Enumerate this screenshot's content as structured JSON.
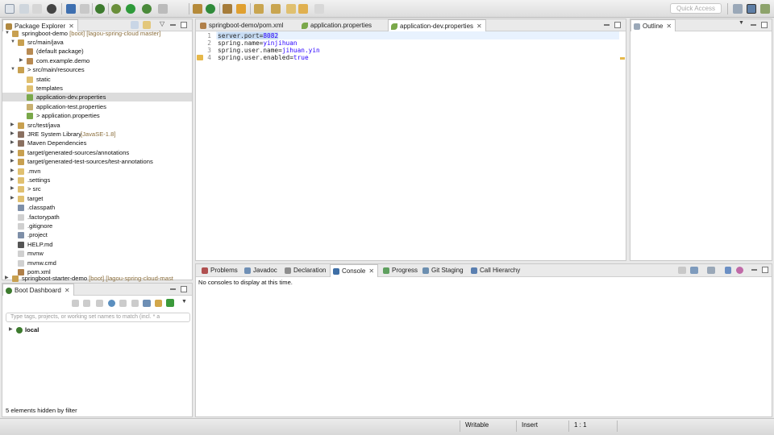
{
  "toolbar": {
    "quick_access_placeholder": "Quick Access"
  },
  "package_explorer": {
    "title": "Package Explorer",
    "project_name": "springboot-demo",
    "project_suffix": "[boot] [lagou-spring-cloud master]",
    "items": [
      {
        "label": "src/main/java",
        "indent": 1,
        "arrow": "open",
        "icon": "source-folder-icon"
      },
      {
        "label": "(default package)",
        "indent": 2,
        "arrow": "",
        "icon": "package-icon"
      },
      {
        "label": "com.example.demo",
        "indent": 2,
        "arrow": "closed",
        "icon": "package-icon"
      },
      {
        "label": "> src/main/resources",
        "indent": 1,
        "arrow": "open",
        "icon": "source-folder-icon"
      },
      {
        "label": "static",
        "indent": 2,
        "arrow": "",
        "icon": "folder-icon"
      },
      {
        "label": "templates",
        "indent": 2,
        "arrow": "",
        "icon": "folder-icon"
      },
      {
        "label": "application-dev.properties",
        "indent": 2,
        "arrow": "",
        "icon": "spring-leaf-icon",
        "selected": true
      },
      {
        "label": "application-test.properties",
        "indent": 2,
        "arrow": "",
        "icon": "properties-file-icon"
      },
      {
        "label": "> application.properties",
        "indent": 2,
        "arrow": "",
        "icon": "spring-leaf-icon"
      },
      {
        "label": "src/test/java",
        "indent": 1,
        "arrow": "closed",
        "icon": "source-folder-icon"
      },
      {
        "label": "JRE System Library",
        "suffix": "[JavaSE-1.8]",
        "indent": 1,
        "arrow": "closed",
        "icon": "library-icon"
      },
      {
        "label": "Maven Dependencies",
        "indent": 1,
        "arrow": "closed",
        "icon": "library-icon"
      },
      {
        "label": "target/generated-sources/annotations",
        "indent": 1,
        "arrow": "closed",
        "icon": "source-folder-icon"
      },
      {
        "label": "target/generated-test-sources/test-annotations",
        "indent": 1,
        "arrow": "closed",
        "icon": "source-folder-icon"
      },
      {
        "label": ".mvn",
        "indent": 1,
        "arrow": "closed",
        "icon": "folder-icon"
      },
      {
        "label": ".settings",
        "indent": 1,
        "arrow": "closed",
        "icon": "folder-icon"
      },
      {
        "label": "> src",
        "indent": 1,
        "arrow": "closed",
        "icon": "folder-icon"
      },
      {
        "label": "target",
        "indent": 1,
        "arrow": "closed",
        "icon": "folder-icon"
      },
      {
        "label": ".classpath",
        "indent": 1,
        "arrow": "",
        "icon": "xml-file-icon"
      },
      {
        "label": ".factorypath",
        "indent": 1,
        "arrow": "",
        "icon": "file-icon"
      },
      {
        "label": ".gitignore",
        "indent": 1,
        "arrow": "",
        "icon": "file-icon"
      },
      {
        "label": ".project",
        "indent": 1,
        "arrow": "",
        "icon": "xml-file-icon"
      },
      {
        "label": "HELP.md",
        "indent": 1,
        "arrow": "",
        "icon": "markdown-file-icon"
      },
      {
        "label": "mvnw",
        "indent": 1,
        "arrow": "",
        "icon": "file-icon"
      },
      {
        "label": "mvnw.cmd",
        "indent": 1,
        "arrow": "",
        "icon": "file-icon"
      },
      {
        "label": "pom.xml",
        "indent": 1,
        "arrow": "",
        "icon": "maven-file-icon"
      }
    ],
    "next_project_name": "springboot-starter-demo",
    "next_project_suffix": "[boot] [lagou-spring-cloud-mast"
  },
  "boot_dashboard": {
    "title": "Boot Dashboard",
    "filter_placeholder": "Type tags, projects, or working set names to match (incl. * a",
    "local_label": "local",
    "hidden_note": "5 elements hidden by filter"
  },
  "editor": {
    "tabs": [
      {
        "label": "springboot-demo/pom.xml",
        "icon": "maven-file-icon"
      },
      {
        "label": "application.properties",
        "icon": "spring-leaf-icon"
      },
      {
        "label": "application-dev.properties",
        "icon": "spring-leaf-icon",
        "active": true
      }
    ],
    "line_numbers": [
      "1",
      "2",
      "3",
      "4"
    ],
    "lines": [
      {
        "key": "server.port",
        "value": "8082",
        "selected": true
      },
      {
        "key": "spring.name",
        "value": "yinjihuan"
      },
      {
        "key": "spring.user.name",
        "value": "jihuan.yin"
      },
      {
        "key": "spring.user.enabled",
        "value": "true"
      }
    ]
  },
  "outline": {
    "title": "Outline"
  },
  "bottom_tabs": [
    {
      "label": "Problems",
      "icon": "problems-icon"
    },
    {
      "label": "Javadoc",
      "icon": "javadoc-icon"
    },
    {
      "label": "Declaration",
      "icon": "declaration-icon"
    },
    {
      "label": "Console",
      "icon": "console-icon",
      "active": true
    },
    {
      "label": "Progress",
      "icon": "progress-icon"
    },
    {
      "label": "Git Staging",
      "icon": "git-staging-icon"
    },
    {
      "label": "Call Hierarchy",
      "icon": "call-hierarchy-icon"
    }
  ],
  "console": {
    "message": "No consoles to display at this time."
  },
  "status_bar": {
    "writable": "Writable",
    "insert": "Insert",
    "position": "1 : 1"
  },
  "colors": {
    "string_value": "#2a00ff",
    "selection": "#c7dcf3",
    "current_line": "#e8f2fe",
    "project_suffix": "#8a6d3b"
  }
}
